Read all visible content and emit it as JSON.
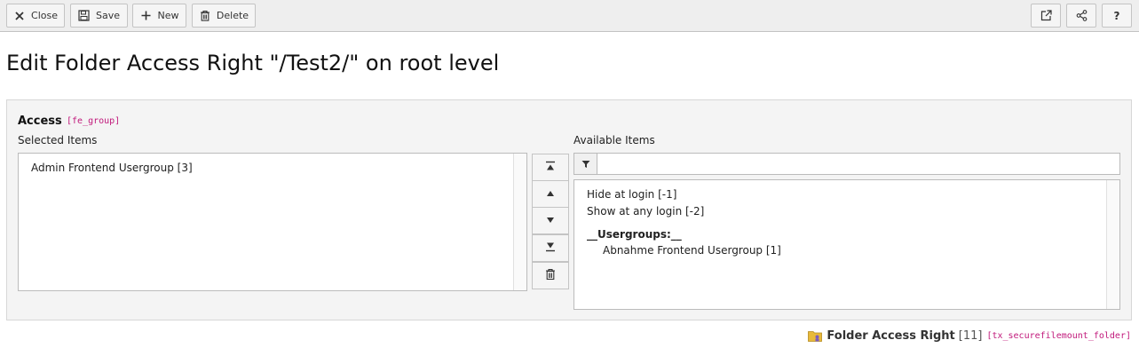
{
  "toolbar": {
    "close_label": "Close",
    "save_label": "Save",
    "new_label": "New",
    "delete_label": "Delete",
    "help_label": "?"
  },
  "page": {
    "title": "Edit Folder Access Right \"/Test2/\" on root level"
  },
  "field": {
    "label": "Access",
    "code": "[fe_group]",
    "selected_label": "Selected Items",
    "available_label": "Available Items",
    "filter_value": "",
    "selected_items": [
      "Admin Frontend Usergroup [3]"
    ],
    "available_items": [
      {
        "label": "Hide at login [-1]",
        "kind": "option"
      },
      {
        "label": "Show at any login [-2]",
        "kind": "option"
      },
      {
        "label": "__Usergroups:__",
        "kind": "group"
      },
      {
        "label": "Abnahme Frontend Usergroup [1]",
        "kind": "option"
      }
    ]
  },
  "footer": {
    "record_name": "Folder Access Right",
    "record_id": "[11]",
    "table": "[tx_securefilemount_folder]"
  }
}
